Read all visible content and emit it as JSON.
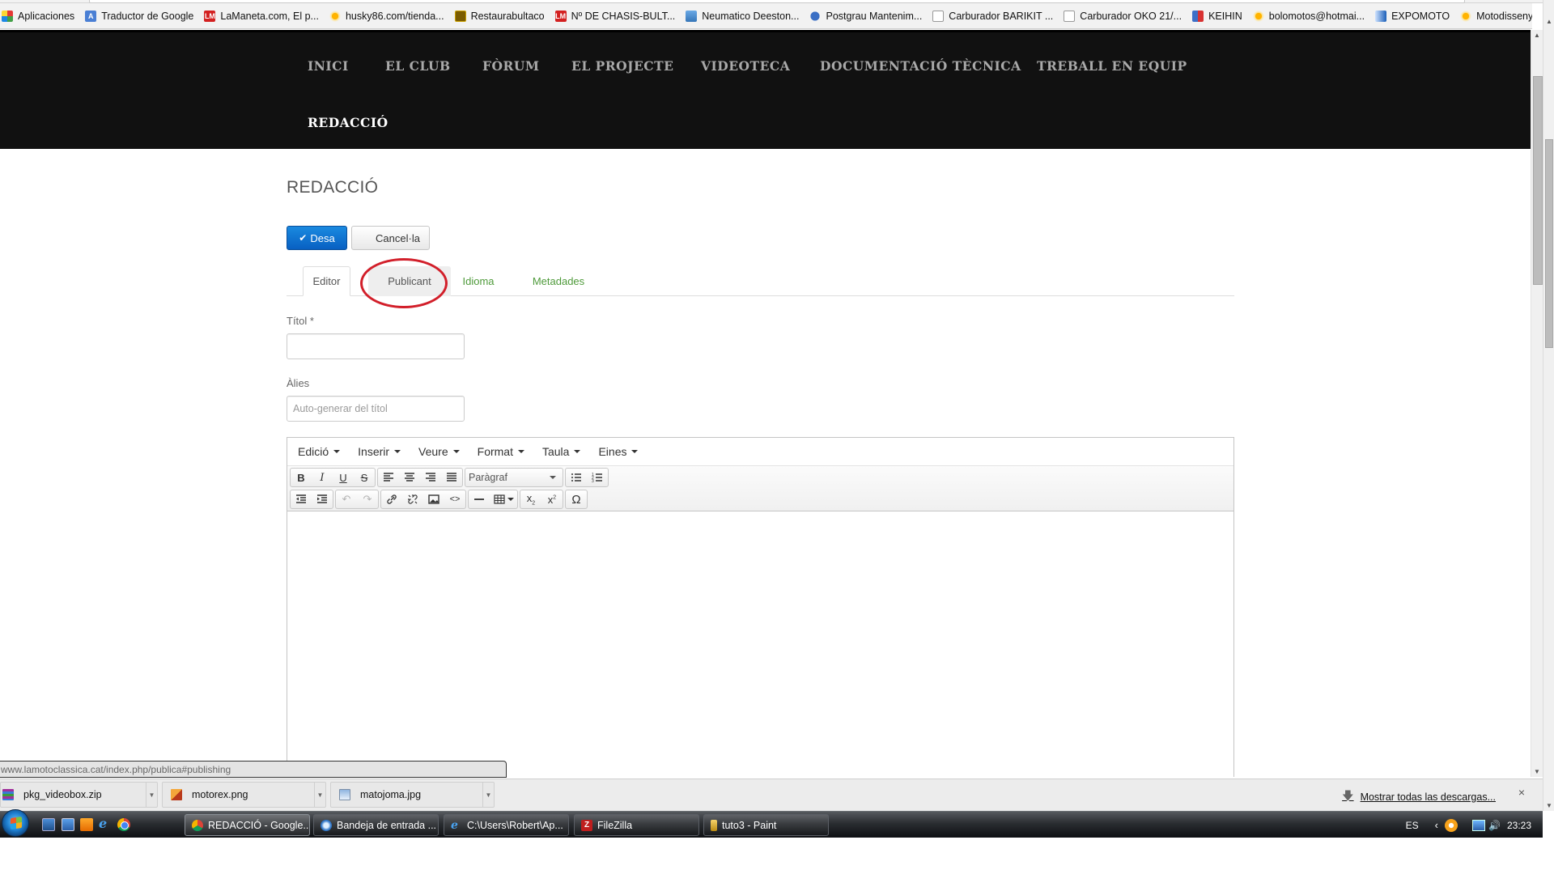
{
  "bookmarks": [
    {
      "label": "Aplicaciones",
      "icon": "apps-icon"
    },
    {
      "label": "Traductor de Google",
      "icon": "translate-icon"
    },
    {
      "label": "LaManeta.com, El p...",
      "icon": "lm-icon"
    },
    {
      "label": "husky86.com/tienda...",
      "icon": "sun-icon"
    },
    {
      "label": "Restaurabultaco",
      "icon": "bultaco-icon"
    },
    {
      "label": "Nº DE CHASIS-BULT...",
      "icon": "lm-icon"
    },
    {
      "label": "Neumatico Deeston...",
      "icon": "tire-icon"
    },
    {
      "label": "Postgrau Mantenim...",
      "icon": "globe-icon"
    },
    {
      "label": "Carburador BARIKIT ...",
      "icon": "page-icon"
    },
    {
      "label": "Carburador OKO 21/...",
      "icon": "page-icon"
    },
    {
      "label": "KEIHIN",
      "icon": "keihin-icon"
    },
    {
      "label": "bolomotos@hotmai...",
      "icon": "sun-icon"
    },
    {
      "label": "EXPOMOTO",
      "icon": "expomoto-icon"
    },
    {
      "label": "Motodisseny Cambr...",
      "icon": "sun-icon"
    }
  ],
  "bookmarks_more": "»",
  "nav": {
    "items": [
      "INICI",
      "EL CLUB",
      "FÒRUM",
      "EL PROJECTE",
      "VIDEOTECA",
      "DOCUMENTACIÓ TÈCNICA",
      "TREBALL EN EQUIP"
    ],
    "active_item": "REDACCIÓ"
  },
  "page": {
    "title": "REDACCIÓ",
    "save_label": "Desa",
    "cancel_label": "Cancel·la",
    "tabs": [
      "Editor",
      "Publicant",
      "Idioma",
      "Metadades"
    ],
    "active_tab": "Editor",
    "highlighted_tab": "Publicant",
    "title_label": "Títol *",
    "title_value": "",
    "alias_label": "Àlies",
    "alias_value": "",
    "alias_placeholder": "Auto-generar del títol"
  },
  "editor": {
    "menus": [
      "Edició",
      "Inserir",
      "Veure",
      "Format",
      "Taula",
      "Eines"
    ],
    "format_select": "Paràgraf",
    "toolbar_row1": [
      "bold",
      "italic",
      "underline",
      "strikethrough",
      "align-left",
      "align-center",
      "align-right",
      "align-justify",
      "format-select",
      "bullet-list",
      "numbered-list"
    ],
    "toolbar_row2": [
      "outdent",
      "indent",
      "undo",
      "redo",
      "link",
      "unlink",
      "image",
      "code",
      "horizontal-rule",
      "table",
      "subscript",
      "superscript",
      "special-character"
    ],
    "content": ""
  },
  "status_url": "www.lamotoclassica.cat/index.php/publica#publishing",
  "downloads": {
    "items": [
      "pkg_videobox.zip",
      "motorex.png",
      "matojoma.jpg"
    ],
    "show_all_label": "Mostrar todas las descargas...",
    "close_label": "×"
  },
  "taskbar": {
    "tasks": [
      "REDACCIÓ - Google...",
      "Bandeja de entrada ...",
      "C:\\Users\\Robert\\Ap...",
      "FileZilla",
      "tuto3 - Paint"
    ],
    "active_task": "REDACCIÓ - Google...",
    "language": "ES",
    "clock": "23:23"
  },
  "colors": {
    "nav_bg": "#111111",
    "nav_text": "#a9a9a9",
    "primary_button": "#0a6fd1",
    "tab_link": "#4e9a3a",
    "annotation_red": "#d21f2a"
  }
}
